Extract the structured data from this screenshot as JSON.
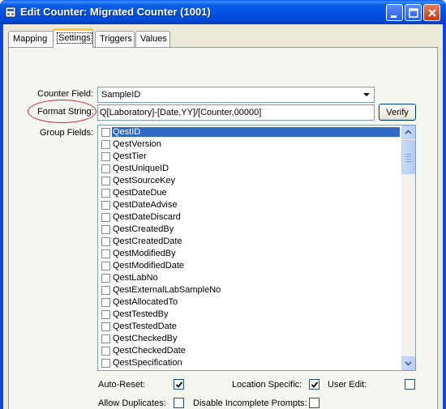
{
  "window": {
    "title": "Edit Counter: Migrated Counter (1001)",
    "icons": {
      "app": "counter-app-icon",
      "minimize": "minimize-icon",
      "maximize": "maximize-icon",
      "close": "close-icon"
    }
  },
  "tabs": [
    {
      "label": "Mapping",
      "active": false
    },
    {
      "label": "Settings",
      "active": true
    },
    {
      "label": "Triggers",
      "active": false
    },
    {
      "label": "Values",
      "active": false
    }
  ],
  "settings": {
    "counter_field": {
      "label": "Counter Field:",
      "value": "SampleID"
    },
    "format_string": {
      "label": "Format String:",
      "value": "Q[Laboratory]-[Date,YY]/[Counter,00000]"
    },
    "verify_button": "Verify",
    "group_fields": {
      "label": "Group Fields:",
      "items": [
        {
          "label": "QestID",
          "checked": false,
          "selected": true
        },
        {
          "label": "QestVersion",
          "checked": false
        },
        {
          "label": "QestTier",
          "checked": false
        },
        {
          "label": "QestUniqueID",
          "checked": false
        },
        {
          "label": "QestSourceKey",
          "checked": false
        },
        {
          "label": "QestDateDue",
          "checked": false
        },
        {
          "label": "QestDateAdvise",
          "checked": false
        },
        {
          "label": "QestDateDiscard",
          "checked": false
        },
        {
          "label": "QestCreatedBy",
          "checked": false
        },
        {
          "label": "QestCreatedDate",
          "checked": false
        },
        {
          "label": "QestModifiedBy",
          "checked": false
        },
        {
          "label": "QestModifiedDate",
          "checked": false
        },
        {
          "label": "QestLabNo",
          "checked": false
        },
        {
          "label": "QestExternalLabSampleNo",
          "checked": false
        },
        {
          "label": "QestAllocatedTo",
          "checked": false
        },
        {
          "label": "QestTestedBy",
          "checked": false
        },
        {
          "label": "QestTestedDate",
          "checked": false
        },
        {
          "label": "QestCheckedBy",
          "checked": false
        },
        {
          "label": "QestCheckedDate",
          "checked": false
        },
        {
          "label": "QestSpecification",
          "checked": false
        }
      ]
    },
    "options": {
      "auto_reset": {
        "label": "Auto-Reset:",
        "checked": true
      },
      "location_specific": {
        "label": "Location Specific:",
        "checked": true
      },
      "user_edit": {
        "label": "User Edit:",
        "checked": false
      },
      "allow_duplicates": {
        "label": "Allow Duplicates:",
        "checked": false
      },
      "disable_incomplete_prompts": {
        "label": "Disable Incomplete Prompts:",
        "checked": false
      }
    }
  },
  "colors": {
    "title_bar": "#0050e0",
    "selection": "#316ac5",
    "annotation_circle": "#cc2a2a",
    "active_tab_accent": "#ffc83c"
  }
}
